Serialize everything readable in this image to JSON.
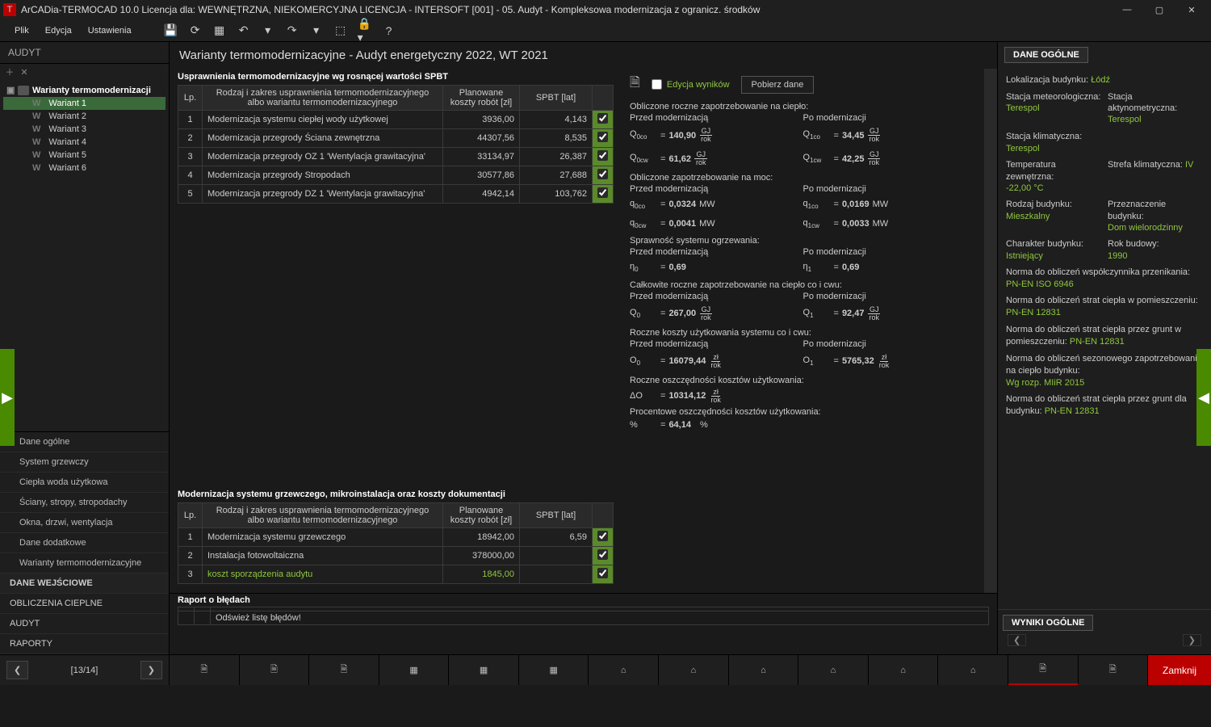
{
  "titlebar": {
    "app": "ArCADia-TERMOCAD 10.0 Licencja dla: WEWNĘTRZNA, NIEKOMERCYJNA LICENCJA - INTERSOFT [001] - 05. Audyt - Kompleksowa modernizacja z ogranicz. środków"
  },
  "menu": {
    "file": "Plik",
    "edit": "Edycja",
    "settings": "Ustawienia"
  },
  "sidebar": {
    "header": "AUDYT",
    "tree_root": "Warianty termomodernizacji",
    "variants": [
      "Wariant 1",
      "Wariant 2",
      "Wariant 3",
      "Wariant 4",
      "Wariant 5",
      "Wariant 6"
    ],
    "nav": {
      "dane_ogolne": "Dane ogólne",
      "system_grzewczy": "System grzewczy",
      "cwu": "Ciepła woda użytkowa",
      "sciany": "Ściany, stropy, stropodachy",
      "okna": "Okna, drzwi, wentylacja",
      "dane_dodatkowe": "Dane dodatkowe",
      "warianty": "Warianty termomodernizacyjne",
      "dane_wejsciowe": "DANE WEJŚCIOWE",
      "obliczenia": "OBLICZENIA CIEPLNE",
      "audyt": "AUDYT",
      "raporty": "RAPORTY"
    }
  },
  "header": "Warianty termomodernizacyjne - Audyt energetyczny 2022, WT 2021",
  "table1": {
    "caption": "Usprawnienia termomodernizacyjne wg rosnącej wartości SPBT",
    "cols": {
      "lp": "Lp.",
      "zakres": "Rodzaj i zakres usprawnienia termomodernizacyjnego albo wariantu termomodernizacyjnego",
      "koszty": "Planowane koszty robót [zł]",
      "spbt": "SPBT [lat]"
    },
    "rows": [
      {
        "lp": "1",
        "zakres": "Modernizacja systemu ciepłej wody użytkowej",
        "koszty": "3936,00",
        "spbt": "4,143"
      },
      {
        "lp": "2",
        "zakres": "Modernizacja przegrody Ściana zewnętrzna",
        "koszty": "44307,56",
        "spbt": "8,535"
      },
      {
        "lp": "3",
        "zakres": "Modernizacja przegrody OZ 1 'Wentylacja grawitacyjna'",
        "koszty": "33134,97",
        "spbt": "26,387"
      },
      {
        "lp": "4",
        "zakres": "Modernizacja przegrody Stropodach",
        "koszty": "30577,86",
        "spbt": "27,688"
      },
      {
        "lp": "5",
        "zakres": "Modernizacja przegrody DZ 1 'Wentylacja grawitacyjna'",
        "koszty": "4942,14",
        "spbt": "103,762"
      }
    ]
  },
  "table2": {
    "caption": "Modernizacja systemu grzewczego, mikroinstalacja oraz koszty dokumentacji",
    "cols": {
      "lp": "Lp.",
      "zakres": "Rodzaj i zakres usprawnienia termomodernizacyjnego albo wariantu termomodernizacyjnego",
      "koszty": "Planowane koszty robót [zł]",
      "spbt": "SPBT [lat]"
    },
    "rows": [
      {
        "lp": "1",
        "zakres": "Modernizacja systemu grzewczego",
        "koszty": "18942,00",
        "spbt": "6,59"
      },
      {
        "lp": "2",
        "zakres": "Instalacja fotowoltaiczna",
        "koszty": "378000,00",
        "spbt": ""
      },
      {
        "lp": "3",
        "zakres": "koszt sporządzenia audytu",
        "koszty": "1845,00",
        "spbt": "",
        "green": true
      }
    ]
  },
  "calc": {
    "edit": "Edycja wyników",
    "fetch": "Pobierz dane",
    "h_cieplo": "Obliczone roczne zapotrzebowanie na ciepło:",
    "przed": "Przed modernizacją",
    "po": "Po modernizacji",
    "q0co": "140,90",
    "q1co": "34,45",
    "q0cw": "61,62",
    "q1cw": "42,25",
    "h_moc": "Obliczone zapotrzebowanie na moc:",
    "qm0co": "0,0324",
    "qm1co": "0,0169",
    "qm0cw": "0,0041",
    "qm1cw": "0,0033",
    "h_spr": "Sprawność systemu ogrzewania:",
    "n0": "0,69",
    "n1": "0,69",
    "h_calk": "Całkowite roczne zapotrzebowanie na ciepło co i cwu:",
    "Q0": "267,00",
    "Q1": "92,47",
    "h_koszty": "Roczne koszty użytkowania systemu co i cwu:",
    "O0": "16079,44",
    "O1": "5765,32",
    "h_osz": "Roczne oszczędności kosztów użytkowania:",
    "dO": "10314,12",
    "h_proc": "Procentowe oszczędności kosztów użytkowania:",
    "proc": "64,14",
    "mw": "MW",
    "gj": "GJ",
    "rok": "rok",
    "zl": "zł",
    "pct": "%"
  },
  "right": {
    "tab": "DANE OGÓLNE",
    "loc_l": "Lokalizacja budynku:",
    "loc_v": "Łódź",
    "meteo_l": "Stacja meteorologiczna:",
    "meteo_v": "Terespol",
    "aktyn_l": "Stacja aktynometryczna:",
    "aktyn_v": "Terespol",
    "klim_l": "Stacja klimatyczna:",
    "klim_v": "Terespol",
    "temp_l": "Temperatura zewnętrzna:",
    "temp_v": "-22,00 °C",
    "strefa_l": "Strefa klimatyczna:",
    "strefa_v": "IV",
    "rodzaj_l": "Rodzaj budynku:",
    "rodzaj_v": "Mieszkalny",
    "przez_l": "Przeznaczenie budynku:",
    "przez_v": "Dom wielorodzinny",
    "char_l": "Charakter budynku:",
    "char_v": "Istniejący",
    "rok_l": "Rok budowy:",
    "rok_v": "1990",
    "n1_l": "Norma do obliczeń współczynnika przenikania: ",
    "n1_v": "PN-EN ISO 6946",
    "n2_l": "Norma do obliczeń strat ciepła w pomieszczeniu: ",
    "n2_v": "PN-EN 12831",
    "n3_l": "Norma do obliczeń strat ciepła przez grunt w pomieszczeniu: ",
    "n3_v": "PN-EN 12831",
    "n4_l": "Norma do obliczeń sezonowego zapotrzebowania na ciepło budynku: ",
    "n4_v": "Wg rozp. MIiR 2015",
    "n5_l": "Norma do obliczeń strat ciepła przez grunt dla budynku: ",
    "n5_v": "PN-EN 12831",
    "results": "WYNIKI OGÓLNE"
  },
  "errors": {
    "caption": "Raport o błędach",
    "refresh": "Odśwież listę błędów!"
  },
  "page": "[13/14]",
  "close": "Zamknij"
}
